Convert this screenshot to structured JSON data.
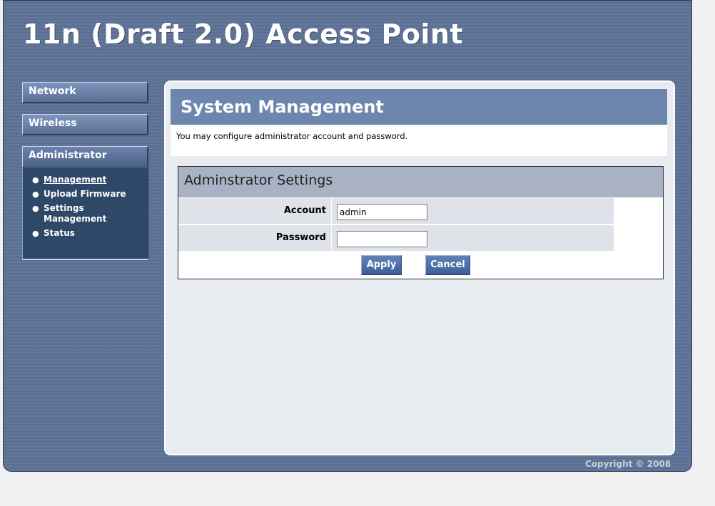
{
  "header": {
    "title": "11n (Draft 2.0) Access Point"
  },
  "nav": {
    "network": "Network",
    "wireless": "Wireless",
    "administrator": "Administrator",
    "submenu": {
      "management": "Management",
      "upload_firmware": "Upload Firmware",
      "settings_management_line1": "Settings",
      "settings_management_line2": "Management",
      "status": "Status"
    }
  },
  "main": {
    "title": "System Management",
    "description": "You may configure administrator account and password.",
    "settings": {
      "title": "Adminstrator Settings",
      "account_label": "Account",
      "account_value": "admin",
      "password_label": "Password",
      "password_value": "",
      "apply_label": "Apply",
      "cancel_label": "Cancel"
    }
  },
  "footer": {
    "copyright": "Copyright © 2008"
  }
}
